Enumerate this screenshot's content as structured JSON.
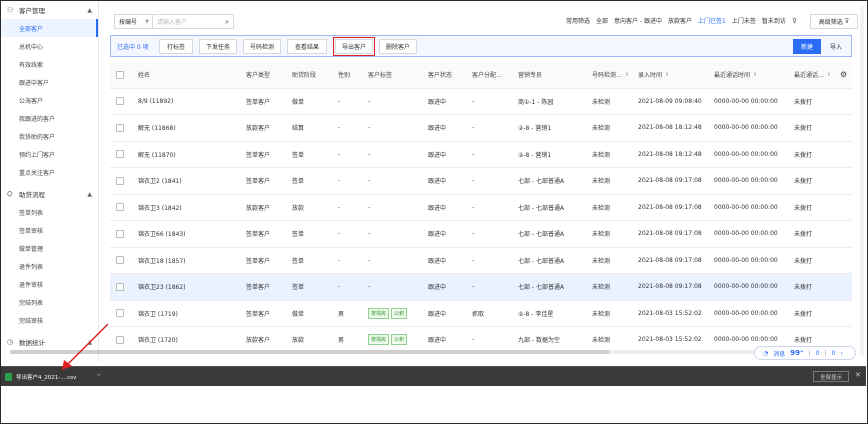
{
  "sidebar": {
    "groups": [
      {
        "title": "客户管理",
        "icon": "users-icon",
        "items": [
          {
            "label": "全部客户",
            "active": true
          },
          {
            "label": "总机中心",
            "active": false
          },
          {
            "label": "有效线索",
            "active": false
          },
          {
            "label": "跟进中客户",
            "active": false
          },
          {
            "label": "公海客户",
            "active": false
          },
          {
            "label": "我跟进的客户",
            "active": false
          },
          {
            "label": "我协助的客户",
            "active": false
          },
          {
            "label": "预约上门客户",
            "active": false
          },
          {
            "label": "重点关注客户",
            "active": false
          }
        ]
      },
      {
        "title": "助贷流程",
        "icon": "flow-icon",
        "items": [
          {
            "label": "签单列表",
            "active": false
          },
          {
            "label": "签单审核",
            "active": false
          },
          {
            "label": "做单管理",
            "active": false
          },
          {
            "label": "退件列表",
            "active": false
          },
          {
            "label": "退件审核",
            "active": false
          },
          {
            "label": "完结列表",
            "active": false
          },
          {
            "label": "完结审核",
            "active": false
          }
        ]
      },
      {
        "title": "数据统计",
        "icon": "chart-icon",
        "items": []
      }
    ]
  },
  "search": {
    "field_select": "按编号",
    "placeholder": "请输入客户"
  },
  "top_filters": {
    "common_label": "常用筛选",
    "all": "全部",
    "intent": "意向客户 - 跟进中",
    "abandoned": "放款客户",
    "visited": "上门已签1",
    "unvisited": "上门未签",
    "unreached": "暂未到访",
    "advanced": "高级筛选"
  },
  "toolbar": {
    "selected_text": "已选中 0 项",
    "buttons": [
      "打标签",
      "下发任务",
      "号码检测",
      "查看结果",
      "导出客户",
      "删除客户"
    ],
    "new_label": "新建",
    "import_label": "导入"
  },
  "table": {
    "columns": [
      "姓名",
      "客户类型",
      "助贷阶段",
      "性别",
      "客户标签",
      "客户状态",
      "客户分配...",
      "营销专员",
      "号码检测...",
      "录入时间",
      "最近通话时间",
      "最近通话..."
    ],
    "rows": [
      {
        "name": "8/9 (11892)",
        "type": "签单客户",
        "stage": "做单",
        "gender": "-",
        "tags": [],
        "status": "跟进中",
        "assign": "-",
        "agent": "商①-1 - 陈园",
        "check": "未检测",
        "created": "2021-08-09 09:08:40",
        "last_call": "0000-00-00 00:00:00",
        "call_state": "未拨打"
      },
      {
        "name": "解无 (11868)",
        "type": "放款客户",
        "stage": "结算",
        "gender": "-",
        "tags": [],
        "status": "跟进中",
        "assign": "-",
        "agent": "②-8 - 营销1",
        "check": "未检测",
        "created": "2021-08-08 18:12:48",
        "last_call": "0000-00-00 00:00:00",
        "call_state": "未拨打"
      },
      {
        "name": "解无 (11870)",
        "type": "签单客户",
        "stage": "签单",
        "gender": "-",
        "tags": [],
        "status": "跟进中",
        "assign": "-",
        "agent": "②-8 - 营销1",
        "check": "未检测",
        "created": "2021-08-08 18:12:48",
        "last_call": "0000-00-00 00:00:00",
        "call_state": "未拨打"
      },
      {
        "name": "锦衣卫2 (1841)",
        "type": "签单客户",
        "stage": "签单",
        "gender": "-",
        "tags": [],
        "status": "跟进中",
        "assign": "-",
        "agent": "七部 - 七部普通A",
        "check": "未检测",
        "created": "2021-08-08 09:17:08",
        "last_call": "0000-00-00 00:00:00",
        "call_state": "未拨打"
      },
      {
        "name": "锦衣卫3 (1842)",
        "type": "放款客户",
        "stage": "放款",
        "gender": "-",
        "tags": [],
        "status": "跟进中",
        "assign": "-",
        "agent": "七部 - 七部普通A",
        "check": "未检测",
        "created": "2021-08-08 09:17:08",
        "last_call": "0000-00-00 00:00:00",
        "call_state": "未拨打"
      },
      {
        "name": "锦衣卫66 (1843)",
        "type": "签单客户",
        "stage": "签单",
        "gender": "-",
        "tags": [],
        "status": "跟进中",
        "assign": "-",
        "agent": "七部 - 七部普通A",
        "check": "未检测",
        "created": "2021-08-08 09:17:08",
        "last_call": "0000-00-00 00:00:00",
        "call_state": "未拨打"
      },
      {
        "name": "锦衣卫18 (1857)",
        "type": "签单客户",
        "stage": "签单",
        "gender": "-",
        "tags": [],
        "status": "跟进中",
        "assign": "-",
        "agent": "七部 - 七部普通A",
        "check": "未检测",
        "created": "2021-08-08 09:17:08",
        "last_call": "0000-00-00 00:00:00",
        "call_state": "未拨打"
      },
      {
        "name": "锦衣卫23 (1862)",
        "type": "签单客户",
        "stage": "签单",
        "gender": "-",
        "tags": [],
        "status": "跟进中",
        "assign": "-",
        "agent": "七部 - 七部普通A",
        "check": "未检测",
        "created": "2021-08-08 09:17:08",
        "last_call": "0000-00-00 00:00:00",
        "call_state": "未拨打"
      },
      {
        "name": "锦衣卫 (1719)",
        "type": "签单客户",
        "stage": "做单",
        "gender": "男",
        "tags": [
          "按揭房",
          "公积"
        ],
        "status": "跟进中",
        "assign": "抓取",
        "agent": "②-8 - 李佳星",
        "check": "未检测",
        "created": "2021-08-03 15:52:02",
        "last_call": "0000-00-00 00:00:00",
        "call_state": "未拨打"
      },
      {
        "name": "锦衣卫 (1720)",
        "type": "放款客户",
        "stage": "放款",
        "gender": "男",
        "tags": [
          "按揭房",
          "公积"
        ],
        "status": "跟进中",
        "assign": "-",
        "agent": "九部 - 数据为空",
        "check": "未检测",
        "created": "2021-08-03 15:52:02",
        "last_call": "0000-00-00 00:00:00",
        "call_state": "未拨打"
      }
    ]
  },
  "message_bar": {
    "label": "消息",
    "count": "99⁺",
    "a": "0",
    "b": "0"
  },
  "download_bar": {
    "file_name": "导出客户4_2021-....csv",
    "show_all": "全部显示"
  },
  "colors": {
    "accent": "#2a6cf6",
    "highlight_box": "#e02020",
    "download_bar": "#3a3a3a"
  }
}
